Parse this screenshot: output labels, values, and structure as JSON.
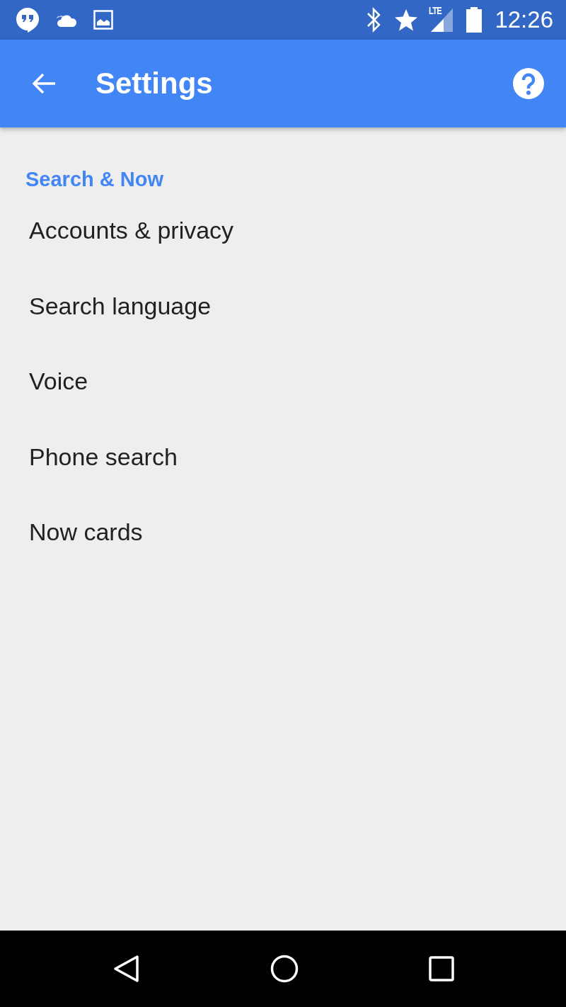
{
  "status_bar": {
    "network": "LTE",
    "time": "12:26"
  },
  "app_bar": {
    "title": "Settings"
  },
  "section": {
    "header": "Search & Now",
    "items": [
      {
        "label": "Accounts & privacy"
      },
      {
        "label": "Search language"
      },
      {
        "label": "Voice"
      },
      {
        "label": "Phone search"
      },
      {
        "label": "Now cards"
      }
    ]
  }
}
